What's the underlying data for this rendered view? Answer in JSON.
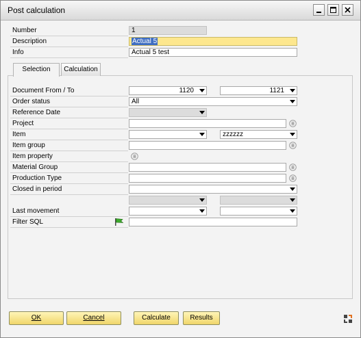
{
  "window": {
    "title": "Post calculation"
  },
  "header": {
    "number_label": "Number",
    "number_value": "1",
    "description_label": "Description",
    "description_value": "Actual 5",
    "info_label": "Info",
    "info_value": "Actual 5 test"
  },
  "tabs": [
    {
      "label": "Selection",
      "active": true
    },
    {
      "label": "Calculation",
      "active": false
    }
  ],
  "selection": {
    "document_label": "Document From / To",
    "document_from": "1120",
    "document_to": "1121",
    "order_status_label": "Order status",
    "order_status_value": "All",
    "reference_date_label": "Reference Date",
    "project_label": "Project",
    "item_label": "Item",
    "item_to": "zzzzzz",
    "item_group_label": "Item group",
    "item_property_label": "Item property",
    "material_group_label": "Material Group",
    "production_type_label": "Production Type",
    "closed_period_label": "Closed in period",
    "last_movement_label": "Last movement",
    "filter_sql_label": "Filter SQL"
  },
  "buttons": {
    "ok": "OK",
    "cancel": "Cancel",
    "calculate": "Calculate",
    "results": "Results"
  },
  "colors": {
    "button_fill": "#f0d66a",
    "highlight_field": "#fde78e",
    "selection": "#3f6ec2"
  }
}
